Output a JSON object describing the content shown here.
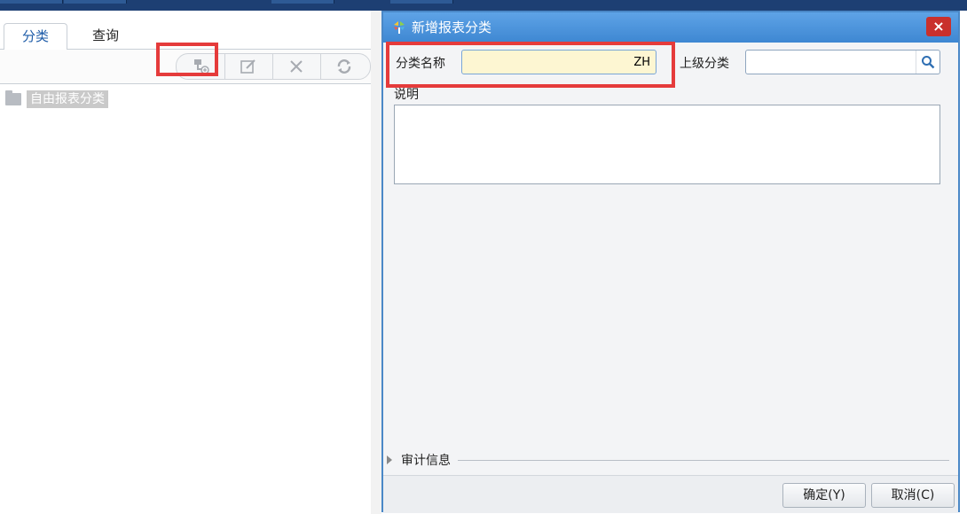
{
  "left": {
    "tabs": [
      {
        "label": "分类",
        "active": true
      },
      {
        "label": "查询",
        "active": false
      }
    ],
    "toolbar": {
      "icons": [
        "add-category-icon",
        "edit-icon",
        "delete-icon",
        "refresh-icon"
      ]
    },
    "tree": {
      "root_label": "自由报表分类"
    }
  },
  "dialog": {
    "title": "新增报表分类",
    "close_label": "×",
    "fields": {
      "name_label": "分类名称",
      "name_value": "ZH",
      "parent_label": "上级分类",
      "parent_value": "",
      "desc_label": "说明",
      "desc_value": ""
    },
    "audit_label": "审计信息",
    "buttons": {
      "ok": "确定(Y)",
      "cancel": "取消(C)"
    }
  },
  "colors": {
    "title_bar": "#3e87d2",
    "highlight_box": "#e53b3b",
    "name_field_bg": "#fdf6d2"
  }
}
